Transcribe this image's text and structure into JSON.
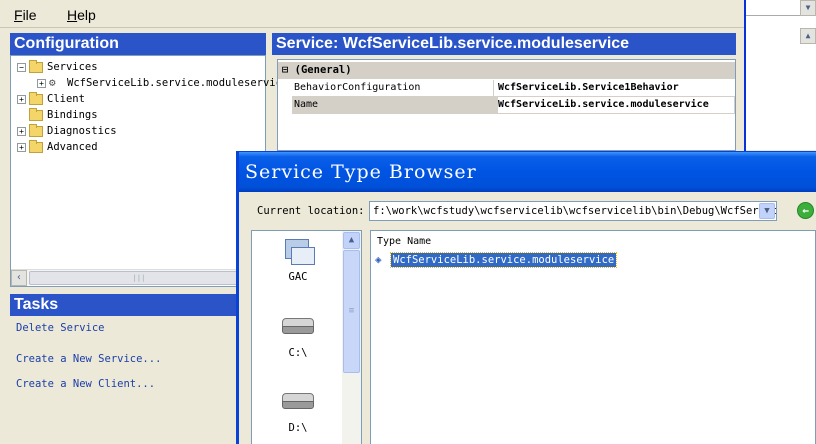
{
  "menubar": {
    "items": [
      {
        "label": "File",
        "mnemonic": "F",
        "rest": "ile"
      },
      {
        "label": "Help",
        "mnemonic": "H",
        "rest": "elp"
      }
    ]
  },
  "config_pane": {
    "title": "Configuration",
    "tree": [
      {
        "label": "Services",
        "expanded": true
      },
      {
        "label": "WcfServiceLib.service.moduleservice",
        "icon": "service-icon"
      },
      {
        "label": "Client"
      },
      {
        "label": "Bindings"
      },
      {
        "label": "Diagnostics"
      },
      {
        "label": "Advanced"
      }
    ]
  },
  "service_pane": {
    "title": "Service: WcfServiceLib.service.moduleservice",
    "category": "(General)",
    "properties": [
      {
        "key": "BehaviorConfiguration",
        "value": "WcfServiceLib.Service1Behavior"
      },
      {
        "key": "Name",
        "value": "WcfServiceLib.service.moduleservice"
      }
    ]
  },
  "tasks_pane": {
    "title": "Tasks",
    "links": [
      "Delete Service",
      "Create a New Service...",
      "Create a New Client..."
    ]
  },
  "dialog": {
    "title": "Service Type Browser",
    "location_label": "Current location:",
    "location_mnemonic_note": "c",
    "location_value": "f:\\work\\wcfstudy\\wcfservicelib\\wcfservicelib\\bin\\Debug\\WcfServiceLib.dll",
    "places": [
      {
        "label": "GAC",
        "icon": "gac-icon"
      },
      {
        "label": "C:\\",
        "icon": "drive-icon"
      },
      {
        "label": "D:\\",
        "icon": "drive-icon"
      }
    ],
    "types_header": "Type Name",
    "types": [
      {
        "label": "WcfServiceLib.service.moduleservice",
        "selected": true
      }
    ]
  },
  "colors": {
    "pane_header": "#2a54c7",
    "dialog_title": "#0054e3",
    "selection": "#316ac5",
    "window_bg": "#ece9d8"
  }
}
